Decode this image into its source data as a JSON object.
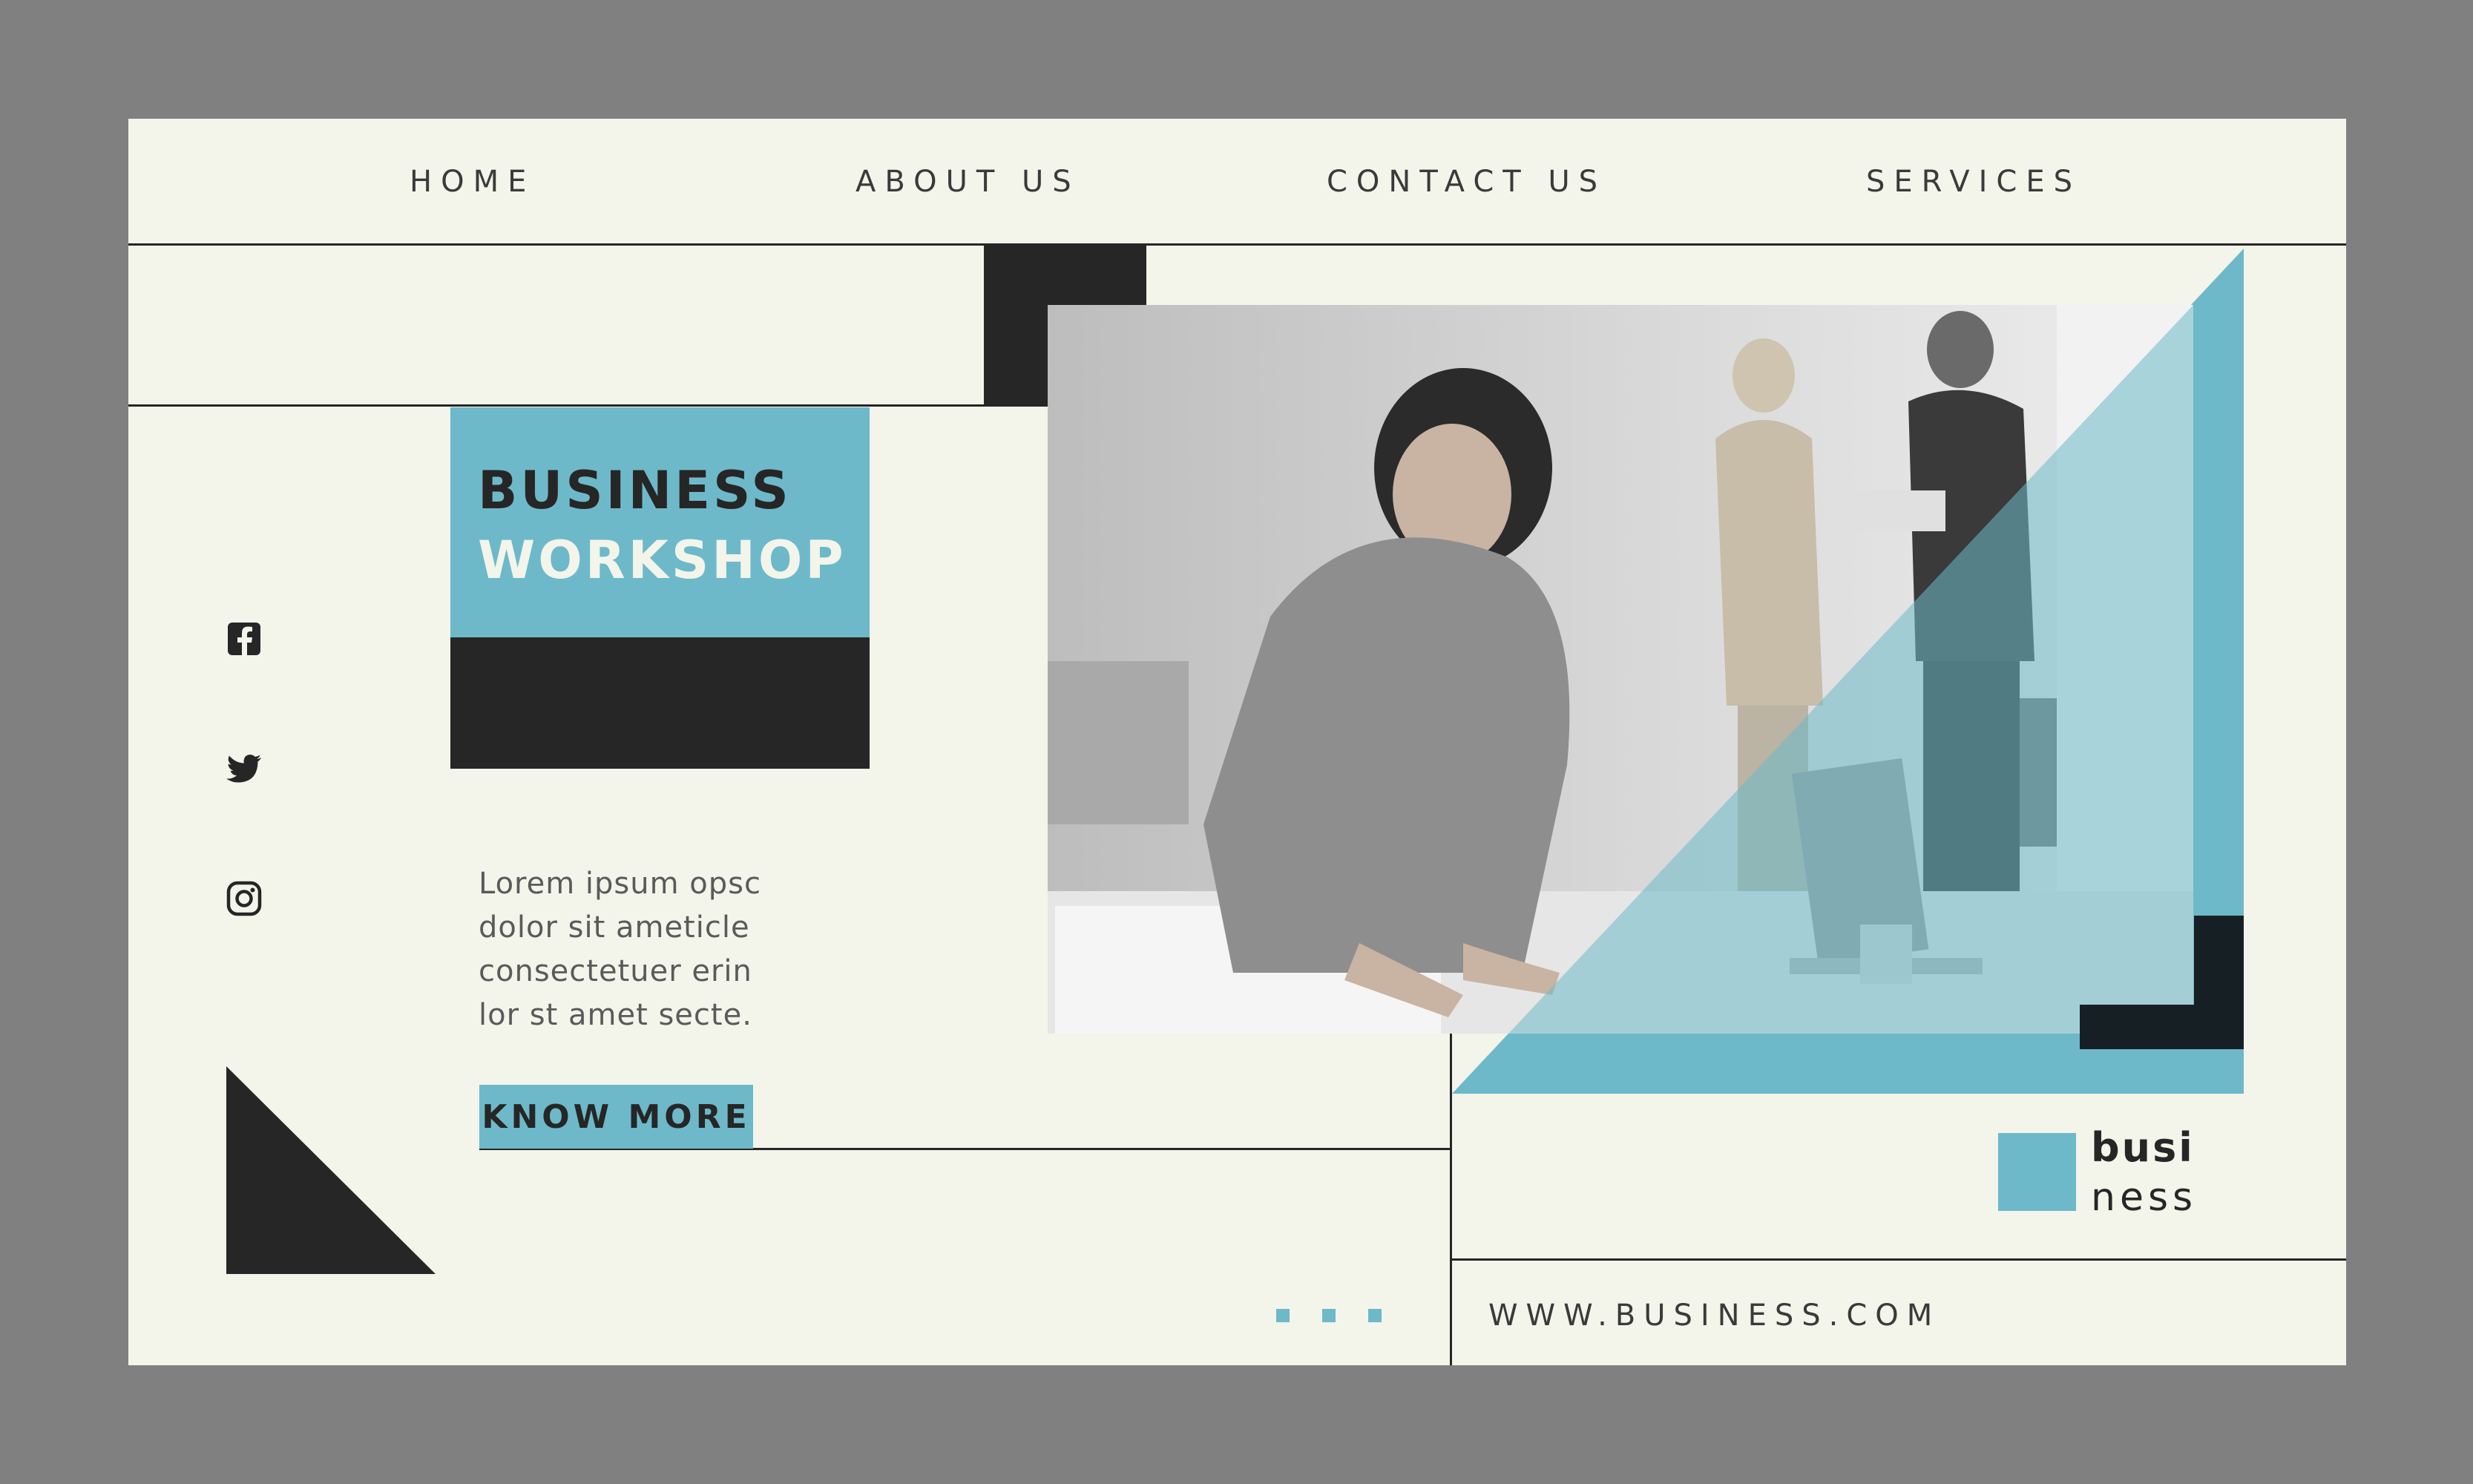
{
  "nav": {
    "items": [
      {
        "label": "HOME"
      },
      {
        "label": "ABOUT US"
      },
      {
        "label": "CONTACT US"
      },
      {
        "label": "SERVICES"
      }
    ]
  },
  "social": {
    "icons": [
      "facebook-icon",
      "twitter-icon",
      "instagram-icon"
    ]
  },
  "hero": {
    "title_line1": "BUSINESS",
    "title_line2": "WORKSHOP",
    "description_lines": [
      "Lorem ipsum opsc",
      "dolor sit ameticle",
      "consectetuer erin",
      "lor st amet secte."
    ],
    "button_label": "KNOW MORE"
  },
  "brand": {
    "line1": "busi",
    "line2": "ness"
  },
  "footer": {
    "url": "WWW.BUSINESS.COM"
  },
  "colors": {
    "accent": "#6db9c9",
    "dark": "#262626",
    "page_background": "#f3f4ea",
    "outer_background": "#808080"
  }
}
